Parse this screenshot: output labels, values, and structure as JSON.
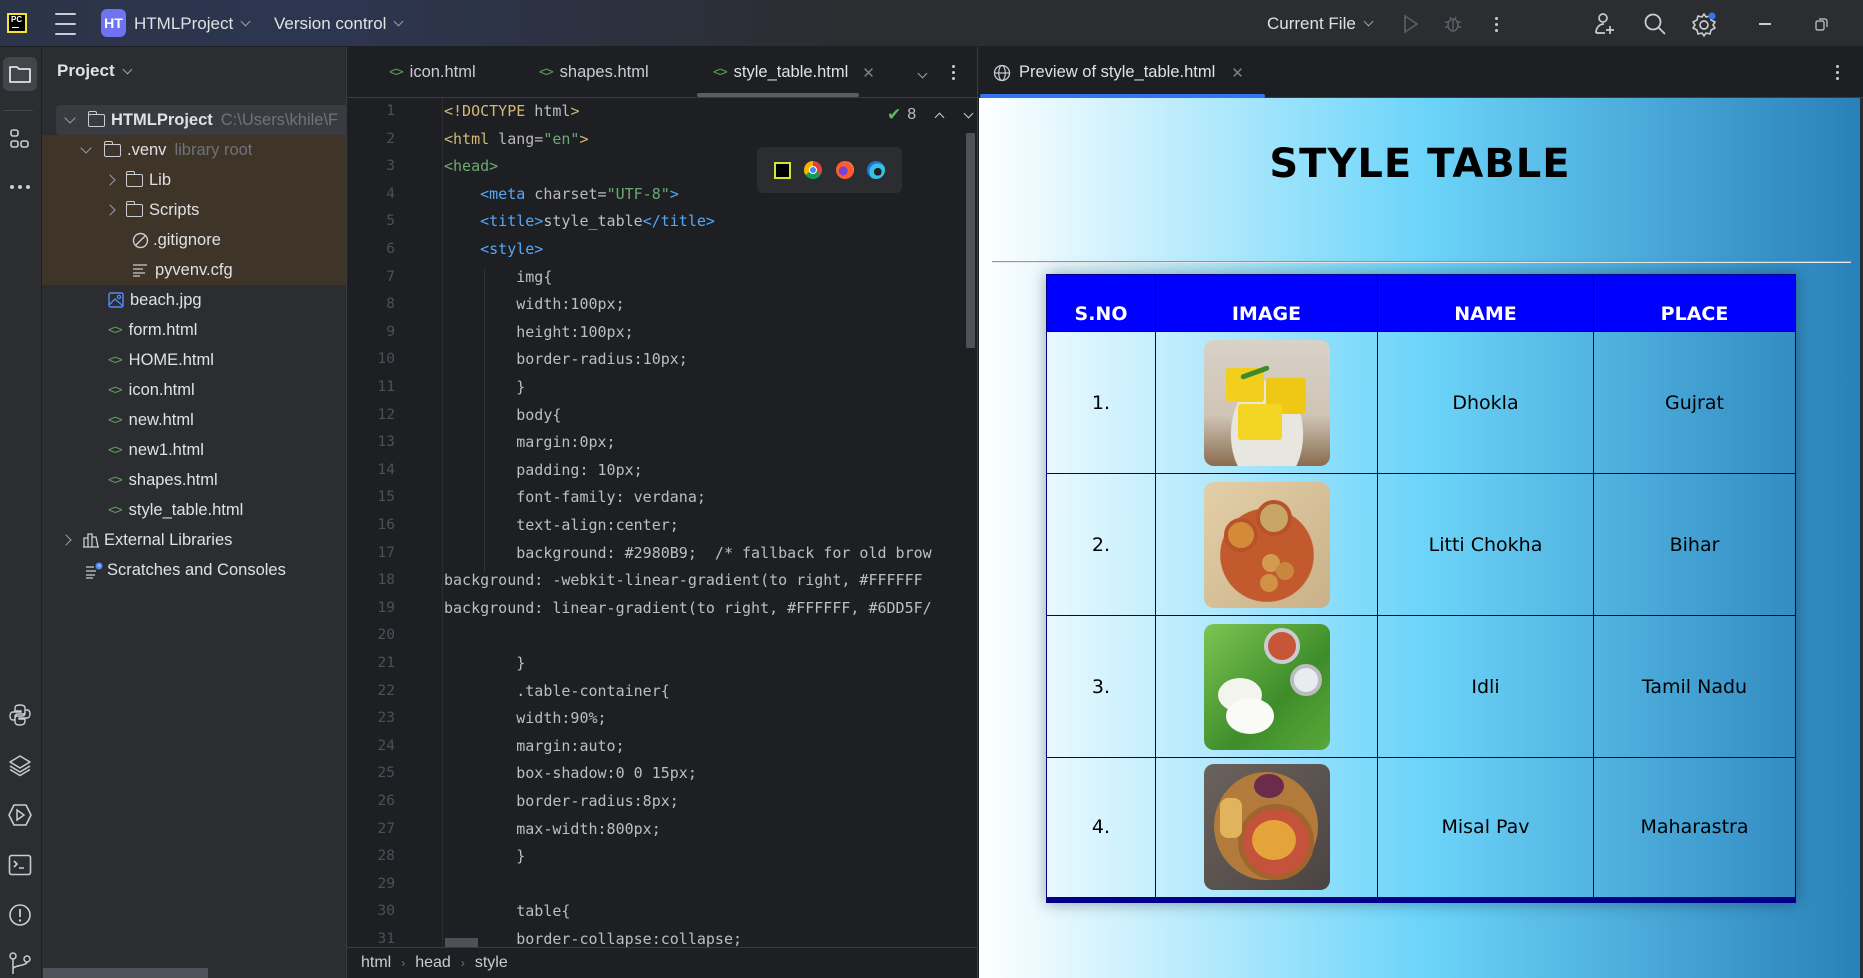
{
  "titlebar": {
    "project_badge": "HT",
    "project_name": "HTMLProject",
    "version_control": "Version control",
    "run_config": "Current File"
  },
  "project_panel": {
    "title": "Project",
    "tree": [
      {
        "label": "HTMLProject",
        "hint": "C:\\Users\\khile\\F",
        "type": "folder",
        "expanded": true,
        "depth": 0
      },
      {
        "label": ".venv",
        "hint": "library root",
        "type": "folder",
        "expanded": true,
        "depth": 1
      },
      {
        "label": "Lib",
        "type": "folder",
        "expanded": false,
        "depth": 2
      },
      {
        "label": "Scripts",
        "type": "folder",
        "expanded": false,
        "depth": 2
      },
      {
        "label": ".gitignore",
        "type": "ignore-file",
        "depth": 2
      },
      {
        "label": "pyvenv.cfg",
        "type": "text-file",
        "depth": 2
      },
      {
        "label": "beach.jpg",
        "type": "image-file",
        "depth": 1
      },
      {
        "label": "form.html",
        "type": "html-file",
        "depth": 1
      },
      {
        "label": "HOME.html",
        "type": "html-file",
        "depth": 1
      },
      {
        "label": "icon.html",
        "type": "html-file",
        "depth": 1
      },
      {
        "label": "new.html",
        "type": "html-file",
        "depth": 1
      },
      {
        "label": "new1.html",
        "type": "html-file",
        "depth": 1
      },
      {
        "label": "shapes.html",
        "type": "html-file",
        "depth": 1
      },
      {
        "label": "style_table.html",
        "type": "html-file",
        "depth": 1
      },
      {
        "label": "External Libraries",
        "type": "library",
        "expanded": false,
        "depth": 0
      },
      {
        "label": "Scratches and Consoles",
        "type": "scratches",
        "depth": 0
      }
    ]
  },
  "editor": {
    "tabs": [
      {
        "label": "icon.html",
        "active": false
      },
      {
        "label": "shapes.html",
        "active": false
      },
      {
        "label": "style_table.html",
        "active": true
      }
    ],
    "inspection_count": "8",
    "lines": [
      {
        "n": "1",
        "text": "<!DOCTYPE html>"
      },
      {
        "n": "2",
        "text": "<html lang=\"en\">"
      },
      {
        "n": "3",
        "text": "<head>"
      },
      {
        "n": "4",
        "text": "    <meta charset=\"UTF-8\">"
      },
      {
        "n": "5",
        "text": "    <title>style_table</title>"
      },
      {
        "n": "6",
        "text": "    <style>"
      },
      {
        "n": "7",
        "text": "        img{"
      },
      {
        "n": "8",
        "text": "        width:100px;"
      },
      {
        "n": "9",
        "text": "        height:100px;"
      },
      {
        "n": "10",
        "text": "        border-radius:10px;"
      },
      {
        "n": "11",
        "text": "        }"
      },
      {
        "n": "12",
        "text": "        body{"
      },
      {
        "n": "13",
        "text": "        margin:0px;"
      },
      {
        "n": "14",
        "text": "        padding: 10px;"
      },
      {
        "n": "15",
        "text": "        font-family: verdana;"
      },
      {
        "n": "16",
        "text": "        text-align:center;"
      },
      {
        "n": "17",
        "text": "        background: #2980B9;  /* fallback for old brow"
      },
      {
        "n": "18",
        "text": "background: -webkit-linear-gradient(to right, #FFFFFF"
      },
      {
        "n": "19",
        "text": "background: linear-gradient(to right, #FFFFFF, #6DD5F/"
      },
      {
        "n": "20",
        "text": ""
      },
      {
        "n": "21",
        "text": "        }"
      },
      {
        "n": "22",
        "text": "        .table-container{"
      },
      {
        "n": "23",
        "text": "        width:90%;"
      },
      {
        "n": "24",
        "text": "        margin:auto;"
      },
      {
        "n": "25",
        "text": "        box-shadow:0 0 15px;"
      },
      {
        "n": "26",
        "text": "        border-radius:8px;"
      },
      {
        "n": "27",
        "text": "        max-width:800px;"
      },
      {
        "n": "28",
        "text": "        }"
      },
      {
        "n": "29",
        "text": ""
      },
      {
        "n": "30",
        "text": "        table{"
      },
      {
        "n": "31",
        "text": "        border-collapse:collapse;"
      }
    ],
    "breadcrumb": [
      "html",
      "head",
      "style"
    ]
  },
  "preview": {
    "tab_label": "Preview of style_table.html",
    "page_title": "STYLE TABLE",
    "table": {
      "headers": [
        "S.NO",
        "IMAGE",
        "NAME",
        "PLACE"
      ],
      "rows": [
        {
          "sno": "1.",
          "image": "dhokla-photo",
          "name": "Dhokla",
          "place": "Gujrat"
        },
        {
          "sno": "2.",
          "image": "litti-chokha-photo",
          "name": "Litti Chokha",
          "place": "Bihar"
        },
        {
          "sno": "3.",
          "image": "idli-photo",
          "name": "Idli",
          "place": "Tamil Nadu"
        },
        {
          "sno": "4.",
          "image": "misal-pav-photo",
          "name": "Misal Pav",
          "place": "Maharastra"
        }
      ]
    },
    "colors": {
      "header_bg": "#0000FF",
      "border": "#00008B",
      "gradient": [
        "#FFFFFF",
        "#6DD5FA",
        "#2980B9"
      ]
    }
  }
}
